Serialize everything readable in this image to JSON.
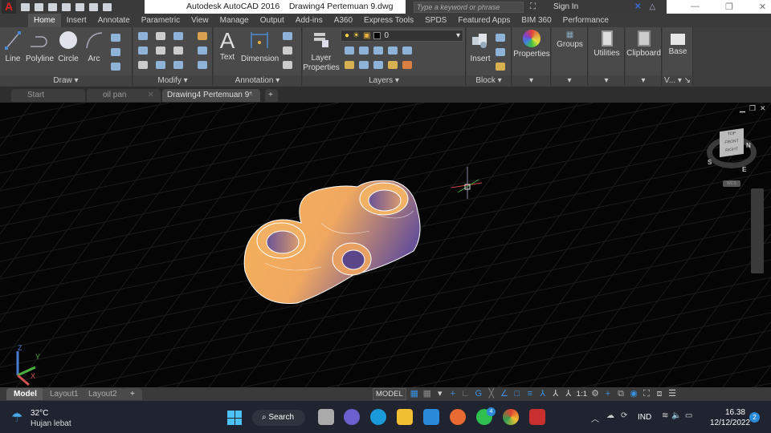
{
  "title_bar": {
    "app_title": "Autodesk AutoCAD 2016",
    "document_title": "Drawing4 Pertemuan 9.dwg",
    "search_placeholder": "Type a keyword or phrase",
    "sign_in": "Sign In"
  },
  "ribbon_tabs": [
    "Home",
    "Insert",
    "Annotate",
    "Parametric",
    "View",
    "Manage",
    "Output",
    "Add-ins",
    "A360",
    "Express Tools",
    "SPDS",
    "Featured Apps",
    "BIM 360",
    "Performance"
  ],
  "ribbon": {
    "draw": {
      "title": "Draw",
      "tools": [
        "Line",
        "Polyline",
        "Circle",
        "Arc"
      ]
    },
    "modify": {
      "title": "Modify"
    },
    "annotation": {
      "title": "Annotation",
      "tools": [
        "Text",
        "Dimension"
      ]
    },
    "layers": {
      "title": "Layers",
      "layer_properties": "Layer Properties",
      "current_layer": "0"
    },
    "block": {
      "title": "Block",
      "insert": "Insert"
    },
    "properties": "Properties",
    "groups": "Groups",
    "utilities": "Utilities",
    "clipboard": "Clipboard",
    "view": {
      "title": "V...",
      "base": "Base"
    }
  },
  "doc_tabs": [
    {
      "label": "Start"
    },
    {
      "label": "oil pan"
    },
    {
      "label": "Drawing4 Pertemuan 9*"
    }
  ],
  "viewcube": {
    "top": "TOP",
    "front": "FRONT",
    "right": "RIGHT",
    "compass": [
      "N",
      "S",
      "E"
    ],
    "wcs": "WCS"
  },
  "ucs": {
    "x": "X",
    "y": "Y",
    "z": "Z"
  },
  "layout_tabs": [
    "Model",
    "Layout1",
    "Layout2"
  ],
  "status": {
    "model": "MODEL",
    "scale": "1:1"
  },
  "taskbar": {
    "weather_temp": "32°C",
    "weather_desc": "Hujan lebat",
    "search": "Search",
    "lang": "IND",
    "time": "16.38",
    "date": "12/12/2022",
    "notifications": "2",
    "whatsapp_badge": "4"
  },
  "colors": {
    "accent": "#3a8fe0",
    "part_orange": "#f5b25a",
    "part_purple": "#6a5296"
  }
}
